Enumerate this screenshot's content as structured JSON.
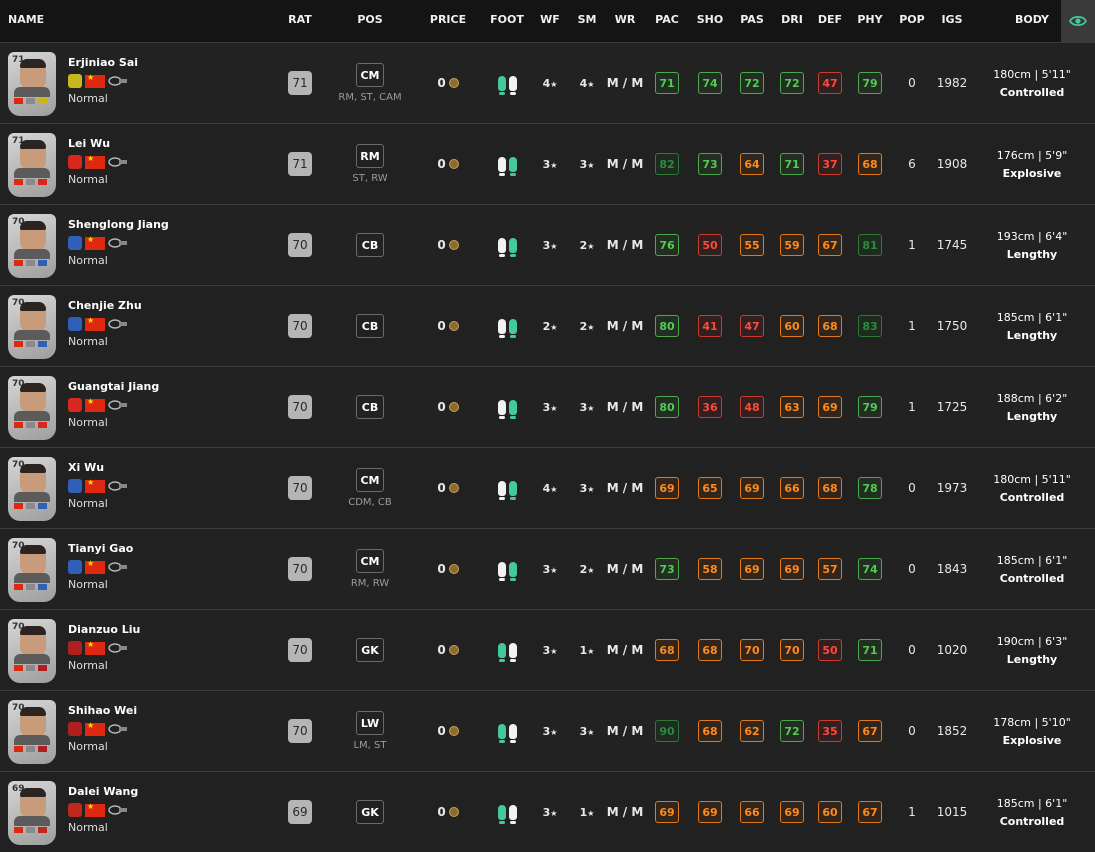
{
  "header": {
    "name": "NAME",
    "rat": "RAT",
    "pos": "POS",
    "price": "PRICE",
    "foot": "FOOT",
    "wf": "WF",
    "sm": "SM",
    "wr": "WR",
    "pac": "PAC",
    "sho": "SHO",
    "pas": "PAS",
    "dri": "DRI",
    "def": "DEF",
    "phy": "PHY",
    "pop": "POP",
    "igs": "IGS",
    "body": "BODY",
    "eye_icon": "eye-icon"
  },
  "colors": {
    "accent_green": "#45c7a0",
    "stat_green": "#55c955",
    "stat_dark_green": "#2d8a3e",
    "stat_orange": "#ff8a1e",
    "stat_red": "#ff4a3a"
  },
  "players": [
    {
      "rating": "71",
      "name": "Erjiniao Sai",
      "level": "Normal",
      "club_color": "#c8b61e",
      "pos": "CM",
      "alt": "RM, ST, CAM",
      "price": "0",
      "strong_foot": "left",
      "wf": "4",
      "sm": "4",
      "wr": "M / M",
      "pac": "71",
      "sho": "74",
      "pas": "72",
      "dri": "72",
      "def": "47",
      "phy": "79",
      "pac_c": "g",
      "sho_c": "g",
      "pas_c": "g",
      "dri_c": "g",
      "def_c": "r",
      "phy_c": "g",
      "pop": "0",
      "igs": "1982",
      "height": "180cm | 5'11\"",
      "body": "Controlled"
    },
    {
      "rating": "71",
      "name": "Lei Wu",
      "level": "Normal",
      "club_color": "#d6281e",
      "pos": "RM",
      "alt": "ST, RW",
      "price": "0",
      "strong_foot": "right",
      "wf": "3",
      "sm": "3",
      "wr": "M / M",
      "pac": "82",
      "sho": "73",
      "pas": "64",
      "dri": "71",
      "def": "37",
      "phy": "68",
      "pac_c": "dg",
      "sho_c": "g",
      "pas_c": "o",
      "dri_c": "g",
      "def_c": "r",
      "phy_c": "o",
      "pop": "6",
      "igs": "1908",
      "height": "176cm | 5'9\"",
      "body": "Explosive"
    },
    {
      "rating": "70",
      "name": "Shenglong Jiang",
      "level": "Normal",
      "club_color": "#2f5fb8",
      "pos": "CB",
      "alt": "",
      "price": "0",
      "strong_foot": "right",
      "wf": "3",
      "sm": "2",
      "wr": "M / M",
      "pac": "76",
      "sho": "50",
      "pas": "55",
      "dri": "59",
      "def": "67",
      "phy": "81",
      "pac_c": "g",
      "sho_c": "r",
      "pas_c": "o",
      "dri_c": "o",
      "def_c": "o",
      "phy_c": "dg",
      "pop": "1",
      "igs": "1745",
      "height": "193cm | 6'4\"",
      "body": "Lengthy"
    },
    {
      "rating": "70",
      "name": "Chenjie Zhu",
      "level": "Normal",
      "club_color": "#2f5fb8",
      "pos": "CB",
      "alt": "",
      "price": "0",
      "strong_foot": "right",
      "wf": "2",
      "sm": "2",
      "wr": "M / M",
      "pac": "80",
      "sho": "41",
      "pas": "47",
      "dri": "60",
      "def": "68",
      "phy": "83",
      "pac_c": "g",
      "sho_c": "r",
      "pas_c": "r",
      "dri_c": "o",
      "def_c": "o",
      "phy_c": "dg",
      "pop": "1",
      "igs": "1750",
      "height": "185cm | 6'1\"",
      "body": "Lengthy"
    },
    {
      "rating": "70",
      "name": "Guangtai Jiang",
      "level": "Normal",
      "club_color": "#d6281e",
      "pos": "CB",
      "alt": "",
      "price": "0",
      "strong_foot": "right",
      "wf": "3",
      "sm": "3",
      "wr": "M / M",
      "pac": "80",
      "sho": "36",
      "pas": "48",
      "dri": "63",
      "def": "69",
      "phy": "79",
      "pac_c": "g",
      "sho_c": "r",
      "pas_c": "r",
      "dri_c": "o",
      "def_c": "o",
      "phy_c": "g",
      "pop": "1",
      "igs": "1725",
      "height": "188cm | 6'2\"",
      "body": "Lengthy"
    },
    {
      "rating": "70",
      "name": "Xi Wu",
      "level": "Normal",
      "club_color": "#2f5fb8",
      "pos": "CM",
      "alt": "CDM, CB",
      "price": "0",
      "strong_foot": "right",
      "wf": "4",
      "sm": "3",
      "wr": "M / M",
      "pac": "69",
      "sho": "65",
      "pas": "69",
      "dri": "66",
      "def": "68",
      "phy": "78",
      "pac_c": "o",
      "sho_c": "o",
      "pas_c": "o",
      "dri_c": "o",
      "def_c": "o",
      "phy_c": "g",
      "pop": "0",
      "igs": "1973",
      "height": "180cm | 5'11\"",
      "body": "Controlled"
    },
    {
      "rating": "70",
      "name": "Tianyi Gao",
      "level": "Normal",
      "club_color": "#2f5fb8",
      "pos": "CM",
      "alt": "RM, RW",
      "price": "0",
      "strong_foot": "right",
      "wf": "3",
      "sm": "2",
      "wr": "M / M",
      "pac": "73",
      "sho": "58",
      "pas": "69",
      "dri": "69",
      "def": "57",
      "phy": "74",
      "pac_c": "g",
      "sho_c": "o",
      "pas_c": "o",
      "dri_c": "o",
      "def_c": "o",
      "phy_c": "g",
      "pop": "0",
      "igs": "1843",
      "height": "185cm | 6'1\"",
      "body": "Controlled"
    },
    {
      "rating": "70",
      "name": "Dianzuo Liu",
      "level": "Normal",
      "club_color": "#b01e1e",
      "pos": "GK",
      "alt": "",
      "price": "0",
      "strong_foot": "left",
      "wf": "3",
      "sm": "1",
      "wr": "M / M",
      "pac": "68",
      "sho": "68",
      "pas": "70",
      "dri": "70",
      "def": "50",
      "phy": "71",
      "pac_c": "o",
      "sho_c": "o",
      "pas_c": "o",
      "dri_c": "o",
      "def_c": "r",
      "phy_c": "g",
      "pop": "0",
      "igs": "1020",
      "height": "190cm | 6'3\"",
      "body": "Lengthy"
    },
    {
      "rating": "70",
      "name": "Shihao Wei",
      "level": "Normal",
      "club_color": "#b01e1e",
      "pos": "LW",
      "alt": "LM, ST",
      "price": "0",
      "strong_foot": "left",
      "wf": "3",
      "sm": "3",
      "wr": "M / M",
      "pac": "90",
      "sho": "68",
      "pas": "62",
      "dri": "72",
      "def": "35",
      "phy": "67",
      "pac_c": "dg",
      "sho_c": "o",
      "pas_c": "o",
      "dri_c": "g",
      "def_c": "r",
      "phy_c": "o",
      "pop": "0",
      "igs": "1852",
      "height": "178cm | 5'10\"",
      "body": "Explosive"
    },
    {
      "rating": "69",
      "name": "Dalei Wang",
      "level": "Normal",
      "club_color": "#c0281e",
      "pos": "GK",
      "alt": "",
      "price": "0",
      "strong_foot": "left",
      "wf": "3",
      "sm": "1",
      "wr": "M / M",
      "pac": "69",
      "sho": "69",
      "pas": "66",
      "dri": "69",
      "def": "60",
      "phy": "67",
      "pac_c": "o",
      "sho_c": "o",
      "pas_c": "o",
      "dri_c": "o",
      "def_c": "o",
      "phy_c": "o",
      "pop": "1",
      "igs": "1015",
      "height": "185cm | 6'1\"",
      "body": "Controlled"
    }
  ]
}
